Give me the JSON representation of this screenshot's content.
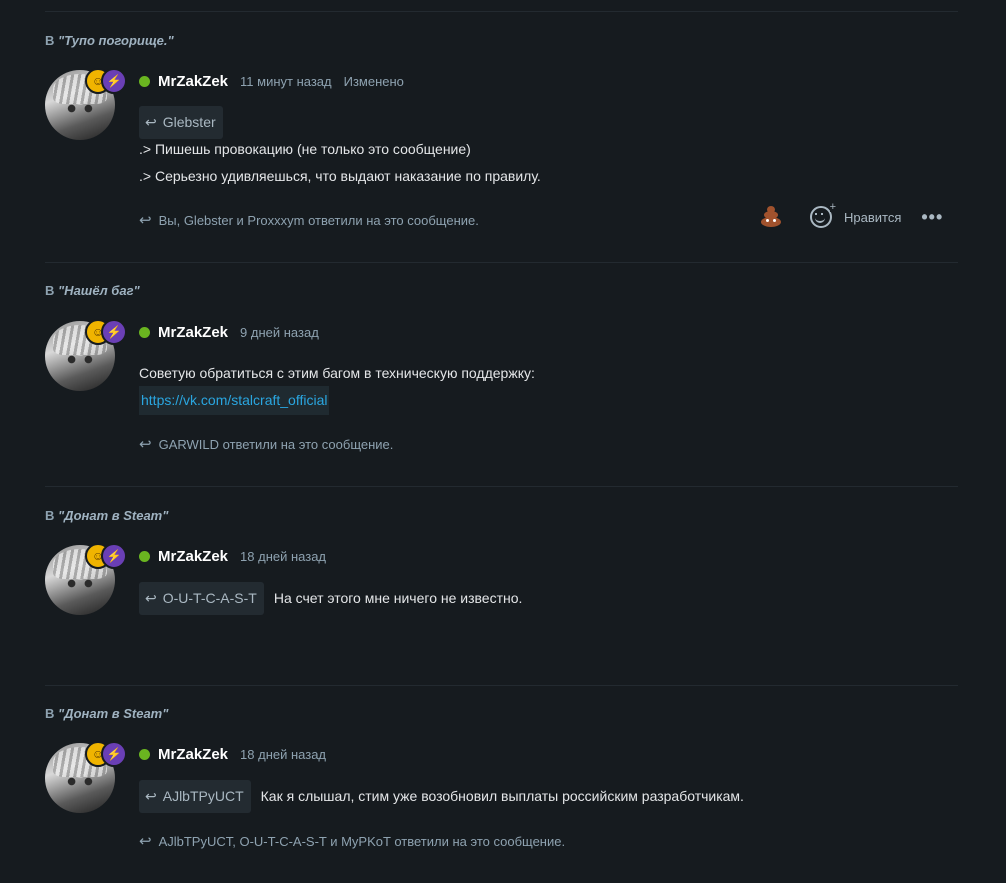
{
  "thread_prefix": "В",
  "posts": [
    {
      "thread": "\"Тупо погорище.\"",
      "author": "MrZakZek",
      "time": "11 минут назад",
      "edited": "Изменено",
      "quote": "Glebster",
      "lines": [
        ".> Пишешь провокацию (не только это сообщение)",
        ".> Серьезно удивляешься, что выдают наказание по правилу."
      ],
      "replies": "Вы, Glebster и Proxxxym ответили на это сообщение.",
      "like_label": "Нравится"
    },
    {
      "thread": "\"Нашёл баг\"",
      "author": "MrZakZek",
      "time": "9 дней назад",
      "lines": [
        "Советую обратиться с этим багом в техническую поддержку:"
      ],
      "link": "https://vk.com/stalcraft_official",
      "replies": "GARWILD ответили на это сообщение."
    },
    {
      "thread": "\"Донат в Steam\"",
      "author": "MrZakZek",
      "time": "18 дней назад",
      "quote": "O-U-T-C-A-S-T",
      "lines": [
        "На счет этого мне ничего не известно."
      ]
    },
    {
      "thread": "\"Донат в Steam\"",
      "author": "MrZakZek",
      "time": "18 дней назад",
      "quote": "AJlbTPyUCT",
      "lines": [
        "Как я слышал, стим уже возобновил выплаты российским разработчикам."
      ],
      "replies": "AJlbTPyUCT, O-U-T-C-A-S-T и MyPKoT ответили на это сообщение."
    }
  ],
  "icons": {
    "reply_arrow": "reply-arrow-icon",
    "reaction": "poop-emoji-icon",
    "add_reaction": "add-reaction-icon",
    "more": "more-options-icon"
  },
  "colors": {
    "background": "#161b1f",
    "online": "#6ab520",
    "link": "#2aa6e0",
    "muted": "#8ea2b0"
  }
}
